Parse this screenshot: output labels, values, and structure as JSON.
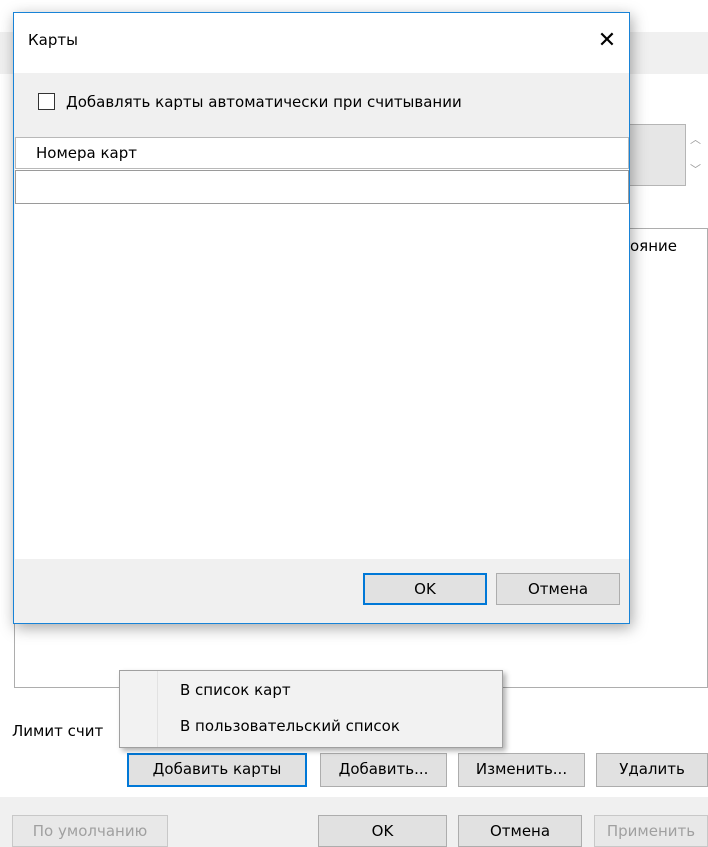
{
  "parent": {
    "column_header": "ояние",
    "limit_label": "Лимит счит",
    "buttons": {
      "add_cards": "Добавить карты",
      "add": "Добавить...",
      "edit": "Изменить...",
      "delete": "Удалить",
      "default": "По умолчанию",
      "ok": "OK",
      "cancel": "Отмена",
      "apply": "Применить"
    }
  },
  "dialog": {
    "title": "Карты",
    "close_glyph": "✕",
    "checkbox_label": "Добавлять карты автоматически при считывании",
    "checkbox_checked": false,
    "grid_header": "Номера карт",
    "grid_row_value": "",
    "ok_label": "OK",
    "cancel_label": "Отмена",
    "accent_color": "#0078d7"
  },
  "context_menu": {
    "items": [
      {
        "label": "В список карт"
      },
      {
        "label": "В пользовательский список"
      }
    ]
  }
}
